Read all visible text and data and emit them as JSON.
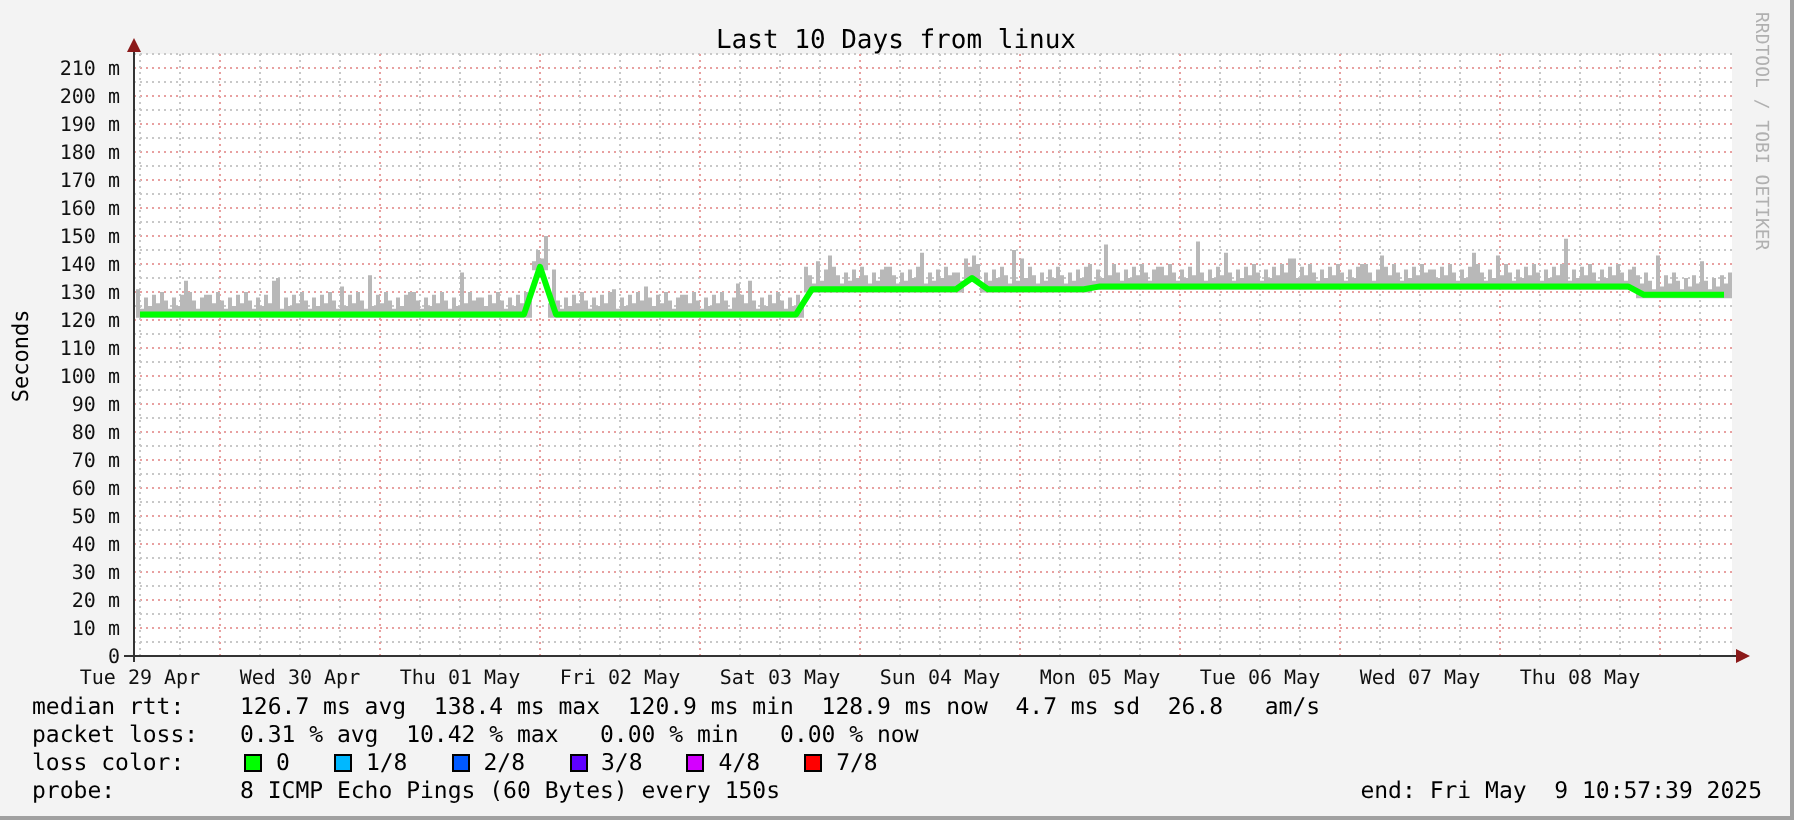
{
  "graph": {
    "side_text": "RRDTOOL / TOBI OETIKER",
    "chart_data": {
      "type": "line",
      "title": "Last 10 Days from linux",
      "ylabel": "Seconds",
      "categories": [
        "Tue 29 Apr",
        null,
        null,
        null,
        null,
        null,
        null,
        null,
        null,
        null,
        "Wed 30 Apr",
        null,
        null,
        null,
        null,
        null,
        null,
        null,
        null,
        null,
        "Thu 01 May",
        null,
        null,
        null,
        null,
        null,
        null,
        null,
        null,
        null,
        "Fri 02 May",
        null,
        null,
        null,
        null,
        null,
        null,
        null,
        null,
        null,
        "Sat 03 May",
        null,
        null,
        null,
        null,
        null,
        null,
        null,
        null,
        null,
        "Sun 04 May",
        null,
        null,
        null,
        null,
        null,
        null,
        null,
        null,
        null,
        "Mon 05 May",
        null,
        null,
        null,
        null,
        null,
        null,
        null,
        null,
        null,
        "Tue 06 May",
        null,
        null,
        null,
        null,
        null,
        null,
        null,
        null,
        null,
        "Wed 07 May",
        null,
        null,
        null,
        null,
        null,
        null,
        null,
        null,
        null,
        "Thu 08 May",
        null,
        null,
        null,
        null,
        null,
        null,
        null,
        null,
        null
      ],
      "series": [
        {
          "color": "#00ff00",
          "values": [
            122,
            122,
            122,
            122,
            122,
            122,
            122,
            122,
            122,
            122,
            122,
            122,
            122,
            122,
            122,
            122,
            122,
            122,
            122,
            122,
            122,
            122,
            122,
            122,
            122,
            139,
            122,
            122,
            122,
            122,
            122,
            122,
            122,
            122,
            122,
            122,
            122,
            122,
            122,
            122,
            122,
            122,
            131,
            131,
            131,
            131,
            131,
            131,
            131,
            131,
            131,
            131,
            135,
            131,
            131,
            131,
            131,
            131,
            131,
            131,
            132,
            132,
            132,
            132,
            132,
            132,
            132,
            132,
            132,
            132,
            132,
            132,
            132,
            132,
            132,
            132,
            132,
            132,
            132,
            132,
            132,
            132,
            132,
            132,
            132,
            132,
            132,
            132,
            132,
            132,
            132,
            132,
            132,
            132,
            129,
            129,
            129,
            129,
            129,
            129
          ]
        }
      ],
      "ylim": [
        0,
        210
      ],
      "grid": true,
      "yticks": [
        {
          "value": 0,
          "label": "0"
        },
        {
          "value": 10,
          "label": "10 m"
        },
        {
          "value": 20,
          "label": "20 m"
        },
        {
          "value": 30,
          "label": "30 m"
        },
        {
          "value": 40,
          "label": "40 m"
        },
        {
          "value": 50,
          "label": "50 m"
        },
        {
          "value": 60,
          "label": "60 m"
        },
        {
          "value": 70,
          "label": "70 m"
        },
        {
          "value": 80,
          "label": "80 m"
        },
        {
          "value": 90,
          "label": "90 m"
        },
        {
          "value": 100,
          "label": "100 m"
        },
        {
          "value": 110,
          "label": "110 m"
        },
        {
          "value": 120,
          "label": "120 m"
        },
        {
          "value": 130,
          "label": "130 m"
        },
        {
          "value": 140,
          "label": "140 m"
        },
        {
          "value": 150,
          "label": "150 m"
        },
        {
          "value": 160,
          "label": "160 m"
        },
        {
          "value": 170,
          "label": "170 m"
        },
        {
          "value": 180,
          "label": "180 m"
        },
        {
          "value": 190,
          "label": "190 m"
        },
        {
          "value": 200,
          "label": "200 m"
        },
        {
          "value": 210,
          "label": "210 m"
        }
      ]
    }
  },
  "legend": {
    "stats": [
      {
        "label": "median rtt:",
        "text": "126.7 ms avg  138.4 ms max  120.9 ms min  128.9 ms now  4.7 ms sd  26.8   am/s"
      },
      {
        "label": "packet loss:",
        "text": "0.31 % avg  10.42 % max   0.00 % min   0.00 % now"
      }
    ],
    "loss_color": {
      "label": "loss color:",
      "items": [
        {
          "label": "0",
          "color": "#00ff00"
        },
        {
          "label": "1/8",
          "color": "#00b8ff"
        },
        {
          "label": "2/8",
          "color": "#0059ff"
        },
        {
          "label": "3/8",
          "color": "#5e00ff"
        },
        {
          "label": "4/8",
          "color": "#d400ff"
        },
        {
          "label": "7/8",
          "color": "#ff0000"
        }
      ]
    },
    "probe": {
      "label": "probe:",
      "text": "8 ICMP Echo Pings (60 Bytes) every 150s"
    },
    "end": "end: Fri May  9 10:57:39 2025"
  }
}
